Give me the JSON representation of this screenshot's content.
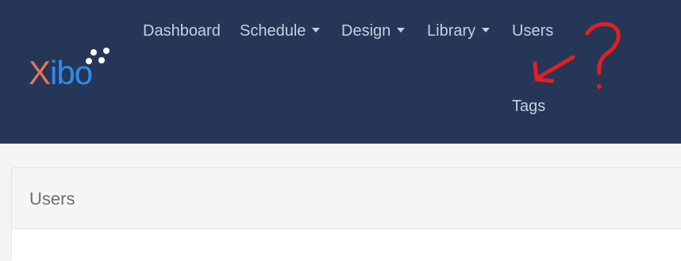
{
  "brand": {
    "logo_first": "X",
    "logo_rest": "ibo",
    "colors": {
      "x": "#e8735a",
      "rest": "#2e8cf0",
      "navbar": "#263657"
    }
  },
  "nav": {
    "dashboard": "Dashboard",
    "schedule": "Schedule",
    "design": "Design",
    "library": "Library",
    "users": "Users",
    "tags": "Tags"
  },
  "page": {
    "card_title": "Users"
  },
  "annotation": {
    "symbol": "?",
    "color": "#e02020"
  }
}
